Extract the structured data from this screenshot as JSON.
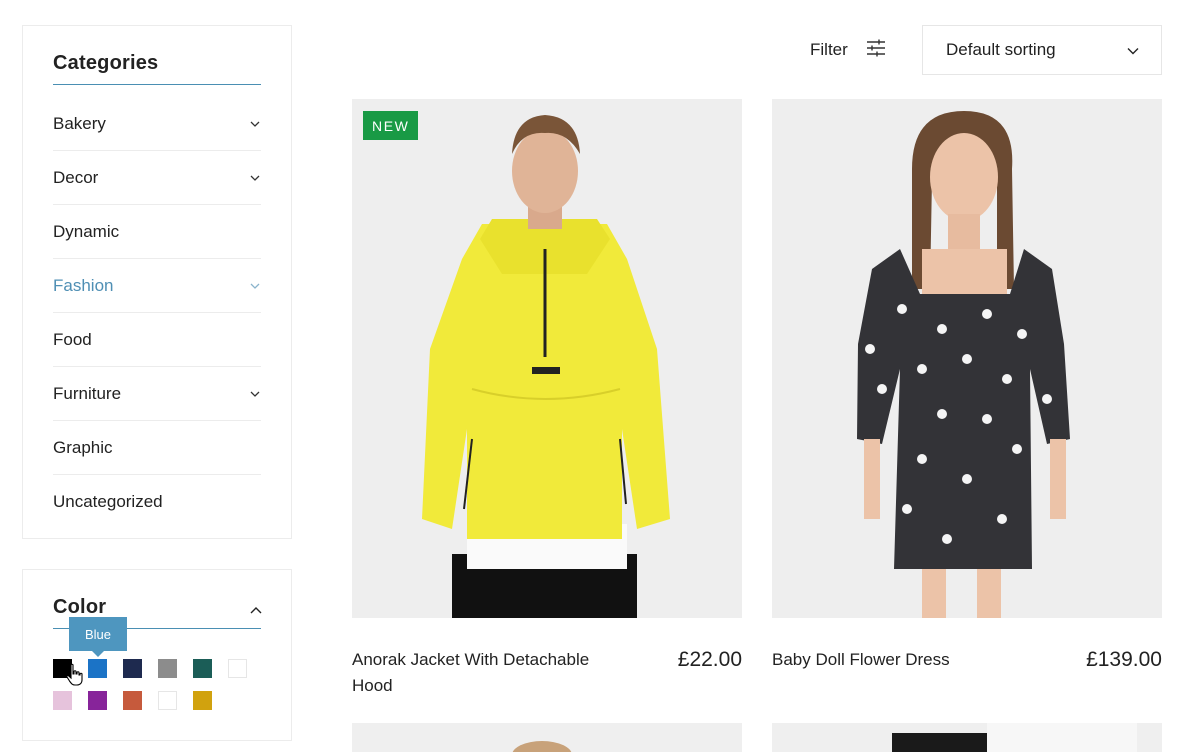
{
  "sidebar": {
    "categories": {
      "title": "Categories",
      "items": [
        {
          "label": "Bakery"
        },
        {
          "label": "Decor"
        },
        {
          "label": "Dynamic"
        },
        {
          "label": "Fashion"
        },
        {
          "label": "Food"
        },
        {
          "label": "Furniture"
        },
        {
          "label": "Graphic"
        },
        {
          "label": "Uncategorized"
        }
      ],
      "active_color": "#4f8fb4"
    },
    "color": {
      "title": "Color",
      "tooltip": "Blue",
      "swatches": [
        "#000000",
        "#1b73c6",
        "#1e2a4f",
        "#8c8c8c",
        "#1b5d57",
        "#ffffff",
        "#e6c3dc",
        "#87249a",
        "#c65a3c",
        "#ffffff",
        "#d1a20e"
      ]
    }
  },
  "toolbar": {
    "filter_label": "Filter",
    "sort_label": "Default sorting"
  },
  "products": [
    {
      "title": "Anorak Jacket With Detachable Hood",
      "price": "£22.00",
      "badge": "NEW"
    },
    {
      "title": "Baby Doll Flower Dress",
      "price": "£139.00"
    }
  ],
  "colors": {
    "badge": "#199a45",
    "tooltip": "#4e96bf",
    "rule": "#4a8fb3"
  }
}
